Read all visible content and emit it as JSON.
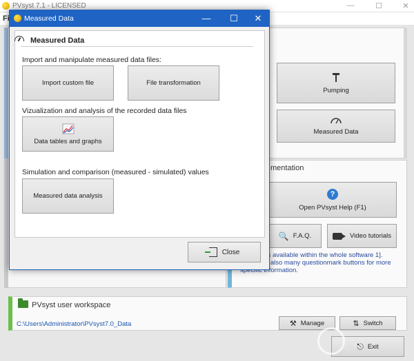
{
  "main_window": {
    "title": "PVsyst 7.1 - LICENSED",
    "menu": "Fi",
    "buttons": {
      "pumping": "Pumping",
      "measured_data": "Measured Data"
    },
    "documentation_header": "mentation",
    "help_button": "Open PVsyst Help (F1)",
    "faq_button": "F.A.Q.",
    "video_button": "Video tutorials",
    "help_text": "ual Help is available within the whole software 1]. There are also many questionmark buttons for more specific information.",
    "workspace": {
      "title": "PVsyst user workspace",
      "path": "C:\\Users\\Administrator\\PVsyst7.0_Data",
      "manage": "Manage",
      "switch": "Switch"
    },
    "exit": "Exit"
  },
  "dialog": {
    "title": "Measured Data",
    "header": "Measured Data",
    "section1": "Import and manipulate measured data files:",
    "import_button": "Import custom file",
    "transform_button": "File transformation",
    "section2": "Vizualization and analysis of the recorded data files",
    "tables_button": "Data tables and graphs",
    "section3": "Simulation and comparison (measured - simulated) values",
    "analysis_button": "Measured data analysis",
    "close_button": "Close"
  }
}
